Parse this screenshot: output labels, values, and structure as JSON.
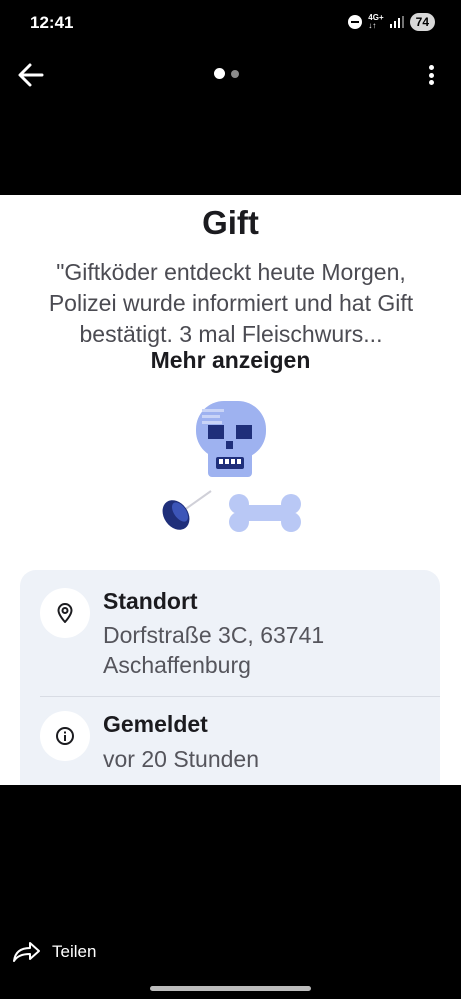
{
  "status_bar": {
    "time": "12:41",
    "network_top": "4G+",
    "network_bottom": "↓↑",
    "battery": "74"
  },
  "top_bar": {
    "back_icon": "arrow-left-icon",
    "menu_icon": "more-vertical-icon",
    "page_count": 2,
    "active_page": 1
  },
  "report": {
    "title": "Gift",
    "description": "\"Giftköder entdeckt heute Morgen, Polizei wurde informiert und hat Gift bestätigt. 3 mal Fleischwurs...",
    "more_label": "Mehr anzeigen",
    "illustration_icon": "poison-skull-bone-icon"
  },
  "info": {
    "location": {
      "icon": "location-pin-icon",
      "label": "Standort",
      "value": "Dorfstraße 3C, 63741 Aschaffenburg"
    },
    "reported": {
      "icon": "info-circle-icon",
      "label": "Gemeldet",
      "value": "vor 20 Stunden"
    }
  },
  "footer": {
    "share_label": "Teilen",
    "share_icon": "share-arrow-icon"
  },
  "colors": {
    "background": "#000000",
    "card": "#ffffff",
    "info_box": "#eef2f8",
    "illustration_blue": "#9eb2f0",
    "illustration_dark": "#1f2f7a"
  }
}
